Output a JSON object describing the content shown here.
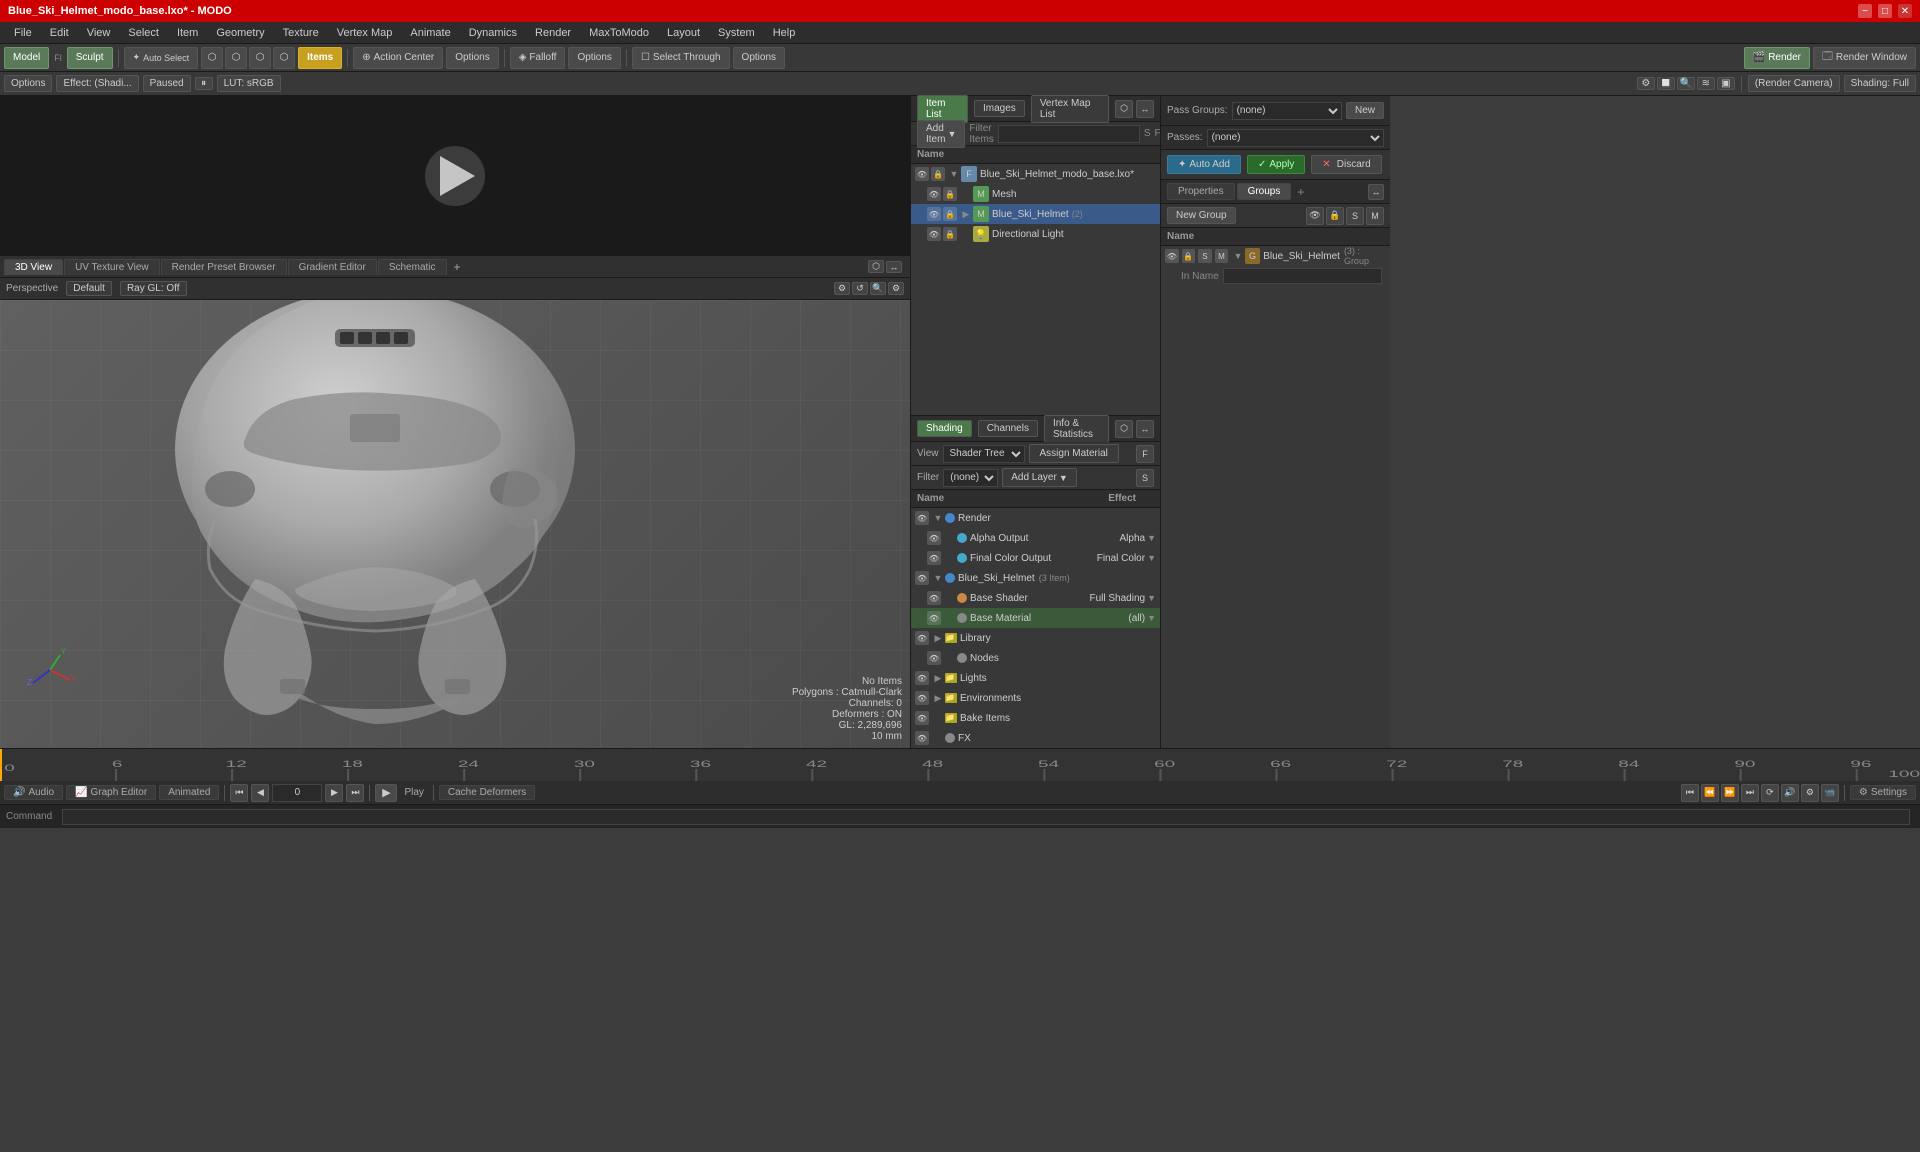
{
  "titlebar": {
    "title": "Blue_Ski_Helmet_modo_base.lxo* - MODO",
    "min": "−",
    "max": "□",
    "close": "✕"
  },
  "menubar": {
    "items": [
      "File",
      "Edit",
      "View",
      "Select",
      "Item",
      "Geometry",
      "Texture",
      "Vertex Map",
      "Animate",
      "Dynamics",
      "Render",
      "MaxToModo",
      "Layout",
      "System",
      "Help"
    ]
  },
  "toolbar": {
    "mode_btns": [
      "Model",
      "Sculpt"
    ],
    "auto_select": "Auto Select",
    "items_label": "Items",
    "action_center": "Action Center",
    "options1": "Options",
    "falloff": "Falloff",
    "options2": "Options",
    "select_through": "Select Through",
    "options3": "Options",
    "render": "Render",
    "render_window": "Render Window"
  },
  "toolbar2": {
    "options": "Options",
    "effect": "Effect: (Shadi...",
    "paused": "Paused",
    "lut": "LUT: sRGB",
    "render_camera": "(Render Camera)",
    "shading": "Shading: Full"
  },
  "view_tabs": {
    "tabs": [
      "3D View",
      "UV Texture View",
      "Render Preset Browser",
      "Gradient Editor",
      "Schematic"
    ],
    "add": "+"
  },
  "viewport": {
    "perspective_label": "Perspective",
    "default_label": "Default",
    "ray_gl": "Ray GL: Off",
    "info": {
      "no_items": "No Items",
      "polygons": "Polygons : Catmull-Clark",
      "channels": "Channels: 0",
      "deformers": "Deformers : ON",
      "gl": "GL: 2,289,696",
      "scale": "10 mm"
    }
  },
  "item_list": {
    "tabs": [
      "Item List",
      "Images",
      "Vertex Map List"
    ],
    "add_item": "Add Item",
    "filter": "Filter Items",
    "s_label": "S",
    "f_label": "F",
    "col_name": "Name",
    "items": [
      {
        "level": 0,
        "label": "Blue_Ski_Helmet_modo_base.lxo*",
        "icon": "file",
        "has_arrow": true,
        "expanded": true
      },
      {
        "level": 1,
        "label": "Mesh",
        "icon": "mesh",
        "has_arrow": false,
        "expanded": false
      },
      {
        "level": 1,
        "label": "Blue_Ski_Helmet",
        "icon": "mesh",
        "has_arrow": true,
        "expanded": true,
        "suffix": "(2)"
      },
      {
        "level": 1,
        "label": "Directional Light",
        "icon": "light",
        "has_arrow": false,
        "expanded": false
      }
    ]
  },
  "shading": {
    "tabs": [
      "Shading",
      "Channels",
      "Info & Statistics"
    ],
    "view_label": "View",
    "view_select": "Shader Tree",
    "assign_material": "Assign Material",
    "filter_label": "Filter",
    "filter_select": "(none)",
    "add_layer": "Add Layer",
    "col_name": "Name",
    "col_effect": "Effect",
    "items": [
      {
        "level": 0,
        "label": "Render",
        "icon": "render",
        "has_arrow": true,
        "expanded": true
      },
      {
        "level": 1,
        "label": "Alpha Output",
        "icon": "alpha",
        "effect": "Alpha",
        "has_arrow": false
      },
      {
        "level": 1,
        "label": "Final Color Output",
        "icon": "final",
        "effect": "Final Color",
        "has_arrow": false
      },
      {
        "level": 0,
        "label": "Blue_Ski_Helmet",
        "icon": "group",
        "suffix": "(3 Item)",
        "has_arrow": true,
        "expanded": true
      },
      {
        "level": 1,
        "label": "Base Shader",
        "icon": "shader",
        "effect": "Full Shading",
        "has_arrow": false
      },
      {
        "level": 1,
        "label": "Base Material",
        "icon": "material",
        "effect": "(all)",
        "has_arrow": false
      },
      {
        "level": 0,
        "label": "Library",
        "icon": "folder",
        "has_arrow": true,
        "expanded": false
      },
      {
        "level": 1,
        "label": "Nodes",
        "icon": "nodes",
        "has_arrow": false
      },
      {
        "level": 0,
        "label": "Lights",
        "icon": "lights",
        "has_arrow": true,
        "expanded": false
      },
      {
        "level": 0,
        "label": "Environments",
        "icon": "env",
        "has_arrow": false
      },
      {
        "level": 0,
        "label": "Bake Items",
        "icon": "bake",
        "has_arrow": false
      },
      {
        "level": 0,
        "label": "FX",
        "icon": "fx",
        "has_arrow": false
      }
    ]
  },
  "pass_groups": {
    "label": "Pass Groups:",
    "select": "(none)",
    "new_btn": "New",
    "passes_label": "Passes:",
    "passes_select": "(none)"
  },
  "auto_add": {
    "auto_add_btn": "Auto Add",
    "apply_btn": "Apply",
    "discard_btn": "Discard"
  },
  "properties": {
    "tabs": [
      "Properties",
      "Groups"
    ],
    "add": "+"
  },
  "groups": {
    "new_group_btn": "New Group",
    "col_name": "Name",
    "icon_btns": [
      "eye",
      "lock",
      "s",
      "m"
    ],
    "items": [
      {
        "label": "Blue_Ski_Helmet",
        "suffix": "(3) : Group",
        "icon": "group",
        "indent": 1
      }
    ],
    "in_name_label": "In Name",
    "in_name_value": ""
  },
  "timeline": {
    "ticks": [
      "0",
      "6",
      "12",
      "18",
      "24",
      "30",
      "36",
      "42",
      "48",
      "54",
      "60",
      "66",
      "72",
      "78",
      "84",
      "90",
      "96"
    ],
    "end": "100"
  },
  "bottom_controls": {
    "audio_btn": "Audio",
    "graph_editor_btn": "Graph Editor",
    "animated_btn": "Animated",
    "frame_value": "0",
    "play_btn": "Play",
    "cache_deformers_btn": "Cache Deformers"
  },
  "statusbar": {
    "settings_btn": "Settings",
    "command_label": "Command"
  }
}
